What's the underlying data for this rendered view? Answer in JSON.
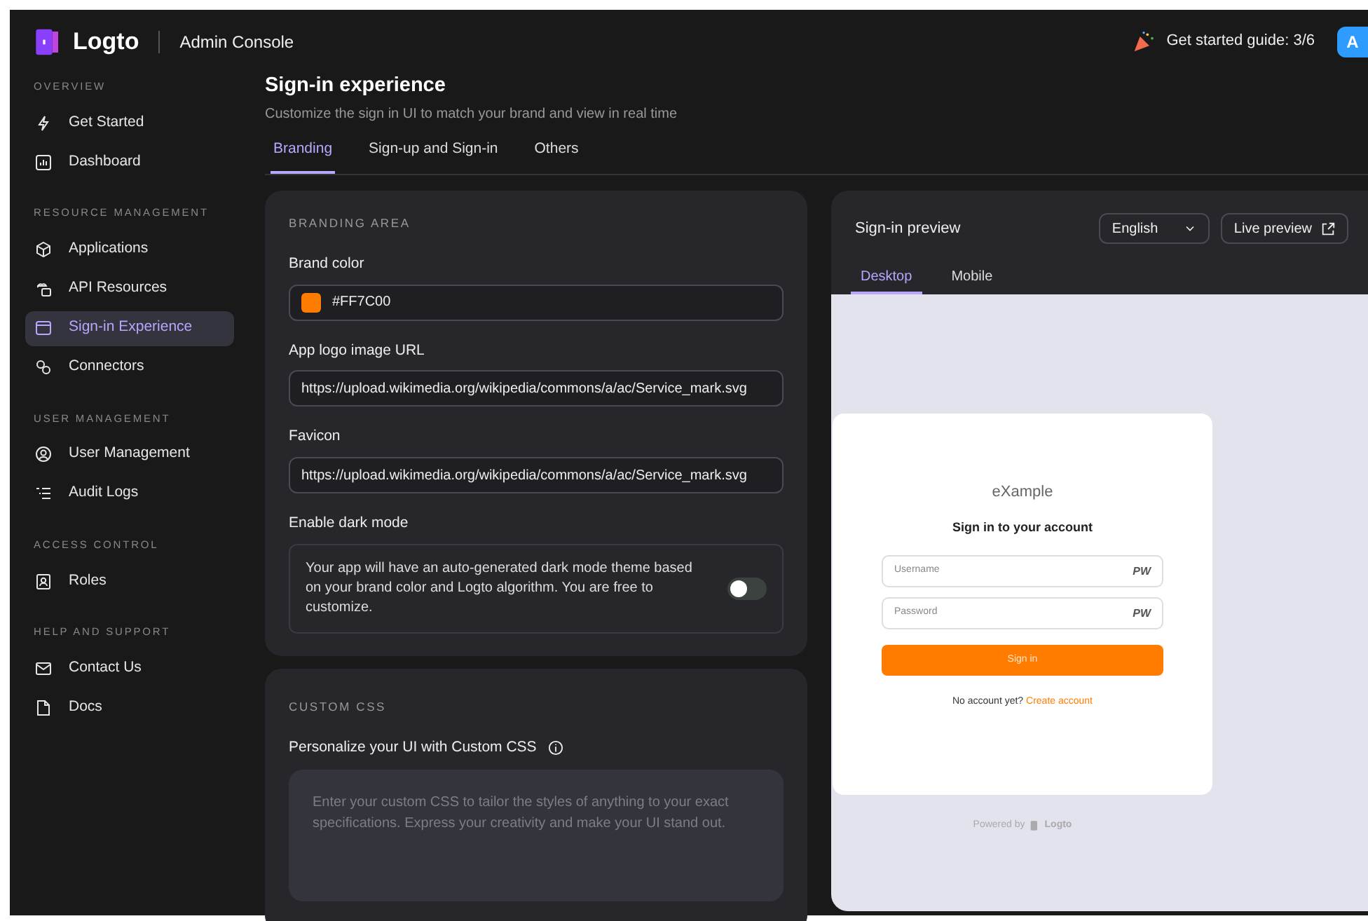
{
  "header": {
    "logo_text": "Logto",
    "app_title": "Admin Console",
    "guide": "Get started guide: 3/6",
    "avatar": "A"
  },
  "sidebar": {
    "sections": [
      {
        "title": "OVERVIEW",
        "items": [
          {
            "label": "Get Started",
            "selected": false
          },
          {
            "label": "Dashboard",
            "selected": false
          }
        ]
      },
      {
        "title": "RESOURCE MANAGEMENT",
        "items": [
          {
            "label": "Applications",
            "selected": false
          },
          {
            "label": "API Resources",
            "selected": false
          },
          {
            "label": "Sign-in Experience",
            "selected": true
          },
          {
            "label": "Connectors",
            "selected": false
          }
        ]
      },
      {
        "title": "USER MANAGEMENT",
        "items": [
          {
            "label": "User Management",
            "selected": false
          },
          {
            "label": "Audit Logs",
            "selected": false
          }
        ]
      },
      {
        "title": "ACCESS CONTROL",
        "items": [
          {
            "label": "Roles",
            "selected": false
          }
        ]
      },
      {
        "title": "HELP AND SUPPORT",
        "items": [
          {
            "label": "Contact Us",
            "selected": false
          },
          {
            "label": "Docs",
            "selected": false
          }
        ]
      }
    ]
  },
  "page": {
    "title": "Sign-in experience",
    "subtitle": "Customize the sign in UI to match your brand and view in real time",
    "tabs": [
      {
        "label": "Branding",
        "selected": true
      },
      {
        "label": "Sign-up and Sign-in",
        "selected": false
      },
      {
        "label": "Others",
        "selected": false
      }
    ]
  },
  "branding": {
    "heading": "BRANDING AREA",
    "brand_color": {
      "label": "Brand color",
      "value": "#FF7C00",
      "color": "#ff7c00"
    },
    "logo_url": {
      "label": "App logo image URL",
      "value": "https://upload.wikimedia.org/wikipedia/commons/a/ac/Service_mark.svg"
    },
    "favicon": {
      "label": "Favicon",
      "value": "https://upload.wikimedia.org/wikipedia/commons/a/ac/Service_mark.svg"
    },
    "dark_mode": {
      "label": "Enable dark mode",
      "description": "Your app will have an auto-generated dark mode theme based on your brand color and Logto algorithm. You are free to customize.",
      "on": false
    }
  },
  "custom_css": {
    "heading": "CUSTOM CSS",
    "label": "Personalize your UI with Custom CSS",
    "placeholder": "Enter your custom CSS to tailor the styles of anything to your exact specifications. Express your creativity and make your UI stand out."
  },
  "preview": {
    "title": "Sign-in preview",
    "language": "English",
    "live_preview": "Live preview",
    "tabs": [
      {
        "label": "Desktop",
        "selected": true
      },
      {
        "label": "Mobile",
        "selected": false
      }
    ],
    "card": {
      "logo_text": "eXample",
      "title": "Sign in to your account",
      "fields": [
        {
          "placeholder": "Username",
          "suffix": "PW"
        },
        {
          "placeholder": "Password",
          "suffix": "PW"
        }
      ],
      "button": "Sign in",
      "prompt": "No account yet?",
      "link": "Create account"
    },
    "footer": "Powered by",
    "footer_brand": "Logto"
  }
}
